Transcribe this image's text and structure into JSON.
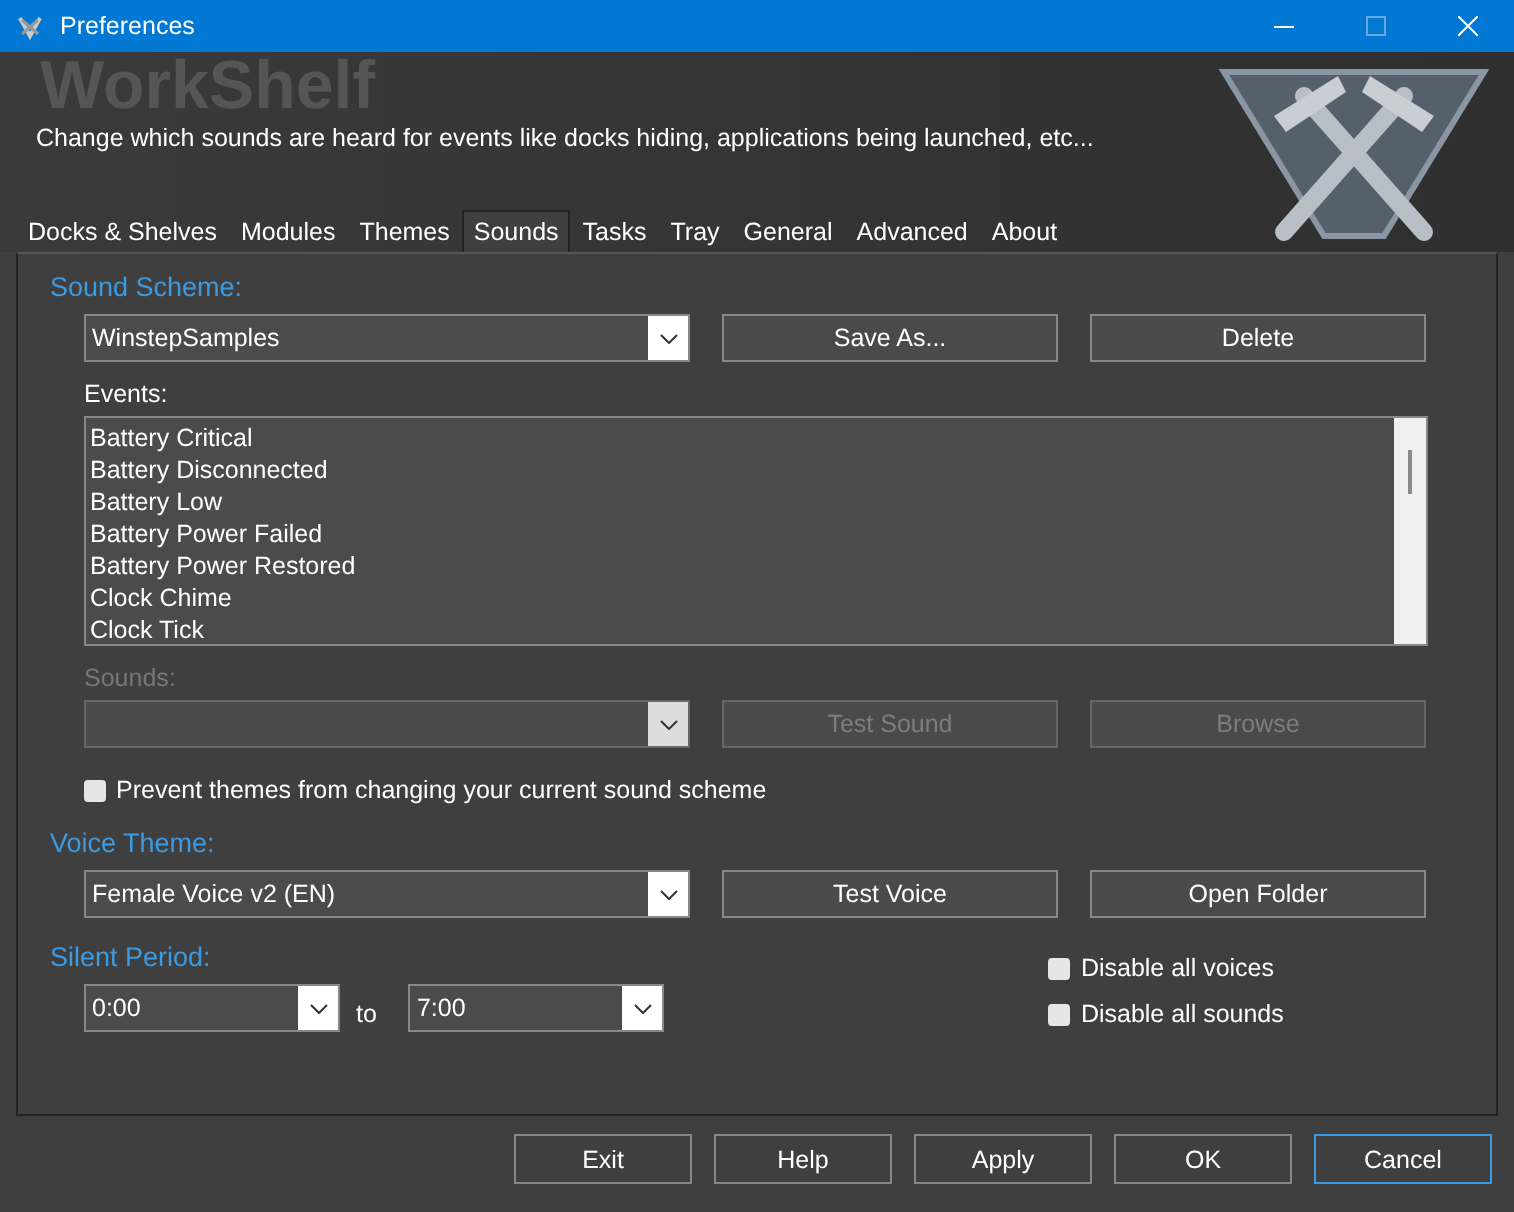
{
  "window": {
    "title": "Preferences"
  },
  "banner": {
    "logo_text": "WorkShelf",
    "description": "Change which sounds are heard for events like docks hiding, applications being launched, etc..."
  },
  "tabs": [
    {
      "label": "Docks & Shelves",
      "selected": false
    },
    {
      "label": "Modules",
      "selected": false
    },
    {
      "label": "Themes",
      "selected": false
    },
    {
      "label": "Sounds",
      "selected": true
    },
    {
      "label": "Tasks",
      "selected": false
    },
    {
      "label": "Tray",
      "selected": false
    },
    {
      "label": "General",
      "selected": false
    },
    {
      "label": "Advanced",
      "selected": false
    },
    {
      "label": "About",
      "selected": false
    }
  ],
  "sound_scheme": {
    "heading": "Sound Scheme:",
    "value": "WinstepSamples",
    "buttons": [
      {
        "label": "Save As...",
        "disabled": false
      },
      {
        "label": "Delete",
        "disabled": false
      }
    ],
    "events_label": "Events:",
    "events": [
      "Battery Critical",
      "Battery Disconnected",
      "Battery Low",
      "Battery Power Failed",
      "Battery Power Restored",
      "Clock Chime",
      "Clock Tick"
    ]
  },
  "sounds": {
    "label": "Sounds:",
    "disabled": true,
    "buttons": [
      {
        "label": "Test Sound",
        "disabled": true
      },
      {
        "label": "Browse",
        "disabled": true
      }
    ]
  },
  "prevent_themes": {
    "label": "Prevent themes from changing your current sound scheme",
    "checked": false
  },
  "voice_theme": {
    "heading": "Voice Theme:",
    "value": "Female Voice v2 (EN)",
    "buttons": [
      {
        "label": "Test Voice",
        "disabled": false
      },
      {
        "label": "Open Folder",
        "disabled": false
      }
    ]
  },
  "silent_period": {
    "heading": "Silent Period:",
    "from": "0:00",
    "to_label": "to",
    "to": "7:00"
  },
  "options": [
    {
      "label": "Disable all voices",
      "checked": false
    },
    {
      "label": "Disable all sounds",
      "checked": false
    }
  ],
  "footer_buttons": [
    {
      "label": "Exit",
      "focused": false
    },
    {
      "label": "Help",
      "focused": false
    },
    {
      "label": "Apply",
      "focused": false
    },
    {
      "label": "OK",
      "focused": false
    },
    {
      "label": "Cancel",
      "focused": true
    }
  ]
}
